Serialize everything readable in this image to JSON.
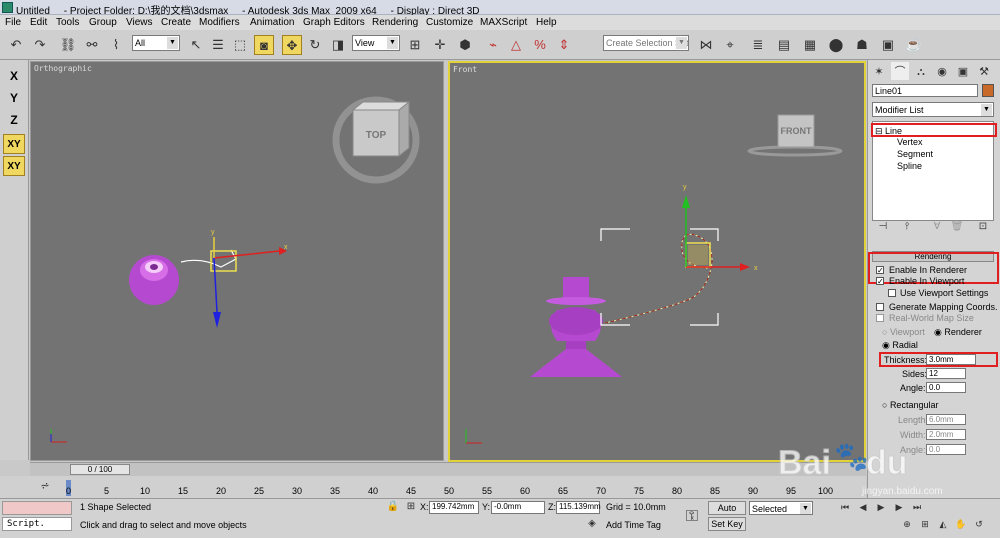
{
  "window": {
    "title": "Untitled     - Project Folder: D:\\我的文档\\3dsmax     - Autodesk 3ds Max  2009 x64     - Display : Direct 3D"
  },
  "menu": [
    "File",
    "Edit",
    "Tools",
    "Group",
    "Views",
    "Create",
    "Modifiers",
    "Animation",
    "Graph Editors",
    "Rendering",
    "Customize",
    "MAXScript",
    "Help"
  ],
  "toolbar": {
    "filter_value": "All",
    "refcoord_value": "View",
    "selection_set_placeholder": "Create Selection Set"
  },
  "left_toolbar": [
    "X",
    "Y",
    "Z",
    "XY",
    "XY"
  ],
  "viewports": {
    "left": {
      "label": "Orthographic",
      "cube_label": "TOP"
    },
    "right": {
      "label": "Front",
      "cube_label": "FRONT"
    }
  },
  "axes": {
    "x": "x",
    "y": "y",
    "z": "z"
  },
  "command_panel": {
    "object_name": "Line01",
    "object_color": "#c86a2a",
    "modifier_list": "Modifier List",
    "stack": [
      "Line",
      "Vertex",
      "Segment",
      "Spline"
    ],
    "rollout_title": "Rendering",
    "enable_in_renderer": "Enable In Renderer",
    "enable_in_viewport": "Enable In Viewport",
    "use_viewport_settings": "Use Viewport Settings",
    "generate_mapping": "Generate Mapping Coords.",
    "real_world_map": "Real-World Map Size",
    "viewport_opt": "Viewport",
    "renderer_opt": "Renderer",
    "radial": "Radial",
    "thickness_label": "Thickness:",
    "thickness_value": "3.0mm",
    "sides_label": "Sides:",
    "sides_value": "12",
    "angle_label": "Angle:",
    "angle_value": "0.0",
    "rectangular": "Rectangular",
    "length_label": "Length:",
    "length_value": "6.0mm",
    "width_label": "Width:",
    "width_value": "2.0mm",
    "angle2_label": "Angle:",
    "angle2_value": "0.0"
  },
  "timeline": {
    "slider": "0 / 100",
    "ticks": [
      "0",
      "5",
      "10",
      "15",
      "20",
      "25",
      "30",
      "35",
      "40",
      "45",
      "50",
      "55",
      "60",
      "65",
      "70",
      "75",
      "80",
      "85",
      "90",
      "95",
      "100"
    ]
  },
  "status": {
    "selected": "1 Shape Selected",
    "prompt": "Click and drag to select and move objects",
    "script": "Script.",
    "x_label": "X:",
    "x_value": "199.742mm",
    "y_label": "Y:",
    "y_value": "-0.0mm",
    "z_label": "Z:",
    "z_value": "115.139mm",
    "grid": "Grid = 10.0mm",
    "add_time_tag": "Add Time Tag",
    "auto_key": "Auto Key",
    "set_key": "Set Key",
    "key_filter": "Selected"
  },
  "watermark": {
    "brand": "Bai",
    "du": "du",
    "site": "jingyan.baidu.com"
  }
}
